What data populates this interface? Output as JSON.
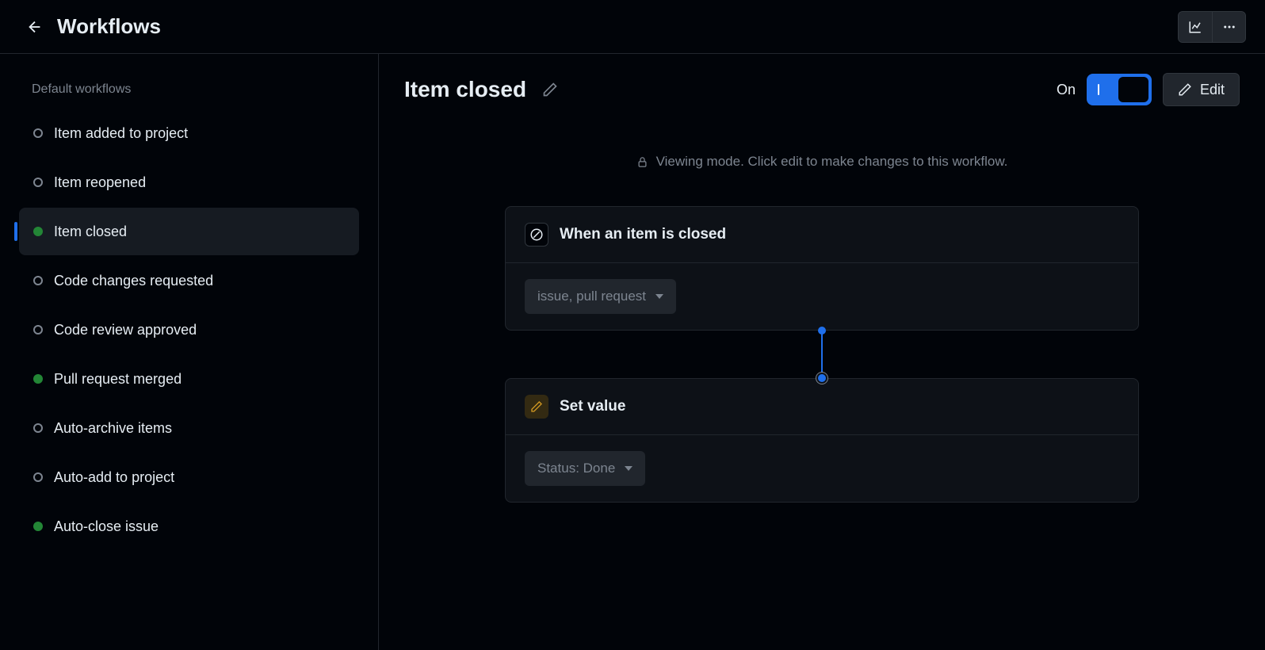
{
  "header": {
    "title": "Workflows"
  },
  "sidebar": {
    "heading": "Default workflows",
    "items": [
      {
        "label": "Item added to project",
        "status": "off",
        "active": false
      },
      {
        "label": "Item reopened",
        "status": "off",
        "active": false
      },
      {
        "label": "Item closed",
        "status": "on",
        "active": true
      },
      {
        "label": "Code changes requested",
        "status": "off",
        "active": false
      },
      {
        "label": "Code review approved",
        "status": "off",
        "active": false
      },
      {
        "label": "Pull request merged",
        "status": "on",
        "active": false
      },
      {
        "label": "Auto-archive items",
        "status": "off",
        "active": false
      },
      {
        "label": "Auto-add to project",
        "status": "off",
        "active": false
      },
      {
        "label": "Auto-close issue",
        "status": "on",
        "active": false
      }
    ]
  },
  "main": {
    "title": "Item closed",
    "toggle_label": "On",
    "edit_label": "Edit",
    "viewing_notice": "Viewing mode. Click edit to make changes to this workflow.",
    "trigger": {
      "title": "When an item is closed",
      "filter": "issue, pull request"
    },
    "action": {
      "title": "Set value",
      "value": "Status: Done"
    }
  }
}
